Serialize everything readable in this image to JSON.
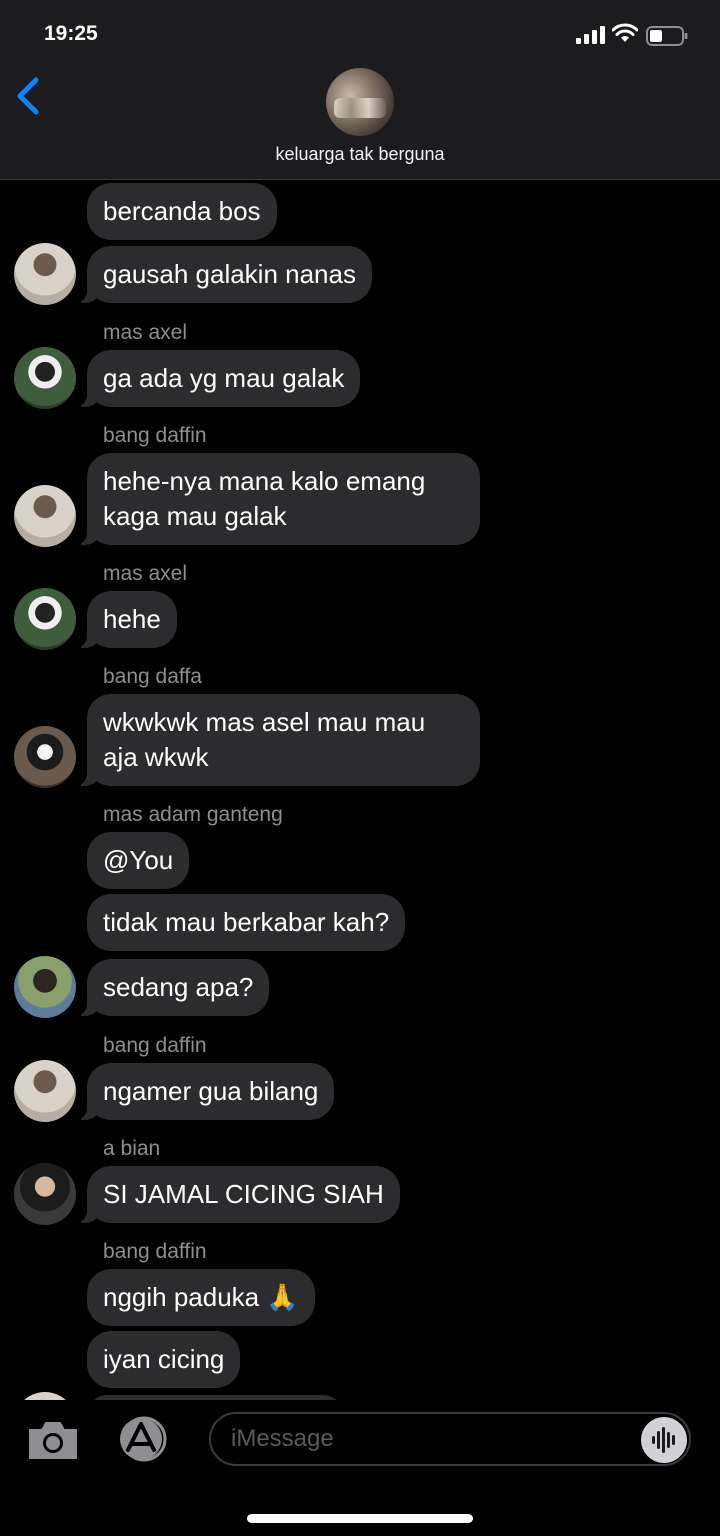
{
  "status_bar": {
    "time": "19:25"
  },
  "header": {
    "group_name": "keluarga tak berguna"
  },
  "messages": [
    {
      "text": "bercanda bos"
    },
    {
      "text": "gausah galakin nanas"
    },
    {
      "sender": "mas axel",
      "text": "ga ada yg mau galak"
    },
    {
      "sender": "bang daffin",
      "text": "hehe-nya mana kalo emang kaga mau galak"
    },
    {
      "sender": "mas axel",
      "text": "hehe"
    },
    {
      "sender": "bang daffa",
      "text": "wkwkwk mas asel mau mau aja wkwk"
    },
    {
      "sender": "mas adam ganteng",
      "text": "@You"
    },
    {
      "text": "tidak mau berkabar kah?"
    },
    {
      "text": "sedang apa?"
    },
    {
      "sender": "bang daffin",
      "text": "ngamer gua bilang"
    },
    {
      "sender": "a bian",
      "text": "SI JAMAL CICING SIAH"
    },
    {
      "sender": "bang daffin",
      "text": "nggih paduka 🙏"
    },
    {
      "text": "iyan cicing"
    }
  ],
  "composer": {
    "placeholder": "iMessage"
  },
  "colors": {
    "accent": "#0a84ff",
    "bubble": "#2c2c2e",
    "header": "#1c1c1e"
  }
}
